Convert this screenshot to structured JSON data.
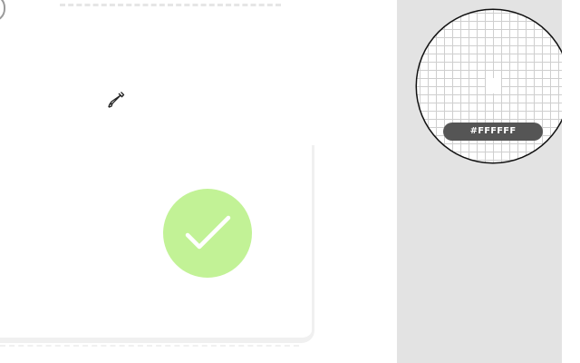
{
  "color_picker": {
    "hex_value": "#FFFFFF",
    "sampled_color": "#FFFFFF"
  },
  "success_indicator": {
    "icon": "checkmark-icon",
    "color": "#C2F296"
  },
  "cursor": {
    "icon": "eyedropper-icon"
  }
}
